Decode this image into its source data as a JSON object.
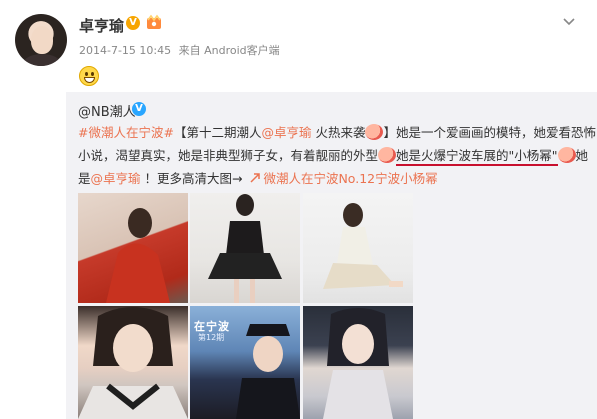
{
  "user": {
    "name": "卓亨瑜",
    "timestamp": "2014-7-15 10:45",
    "source": "来自 Android客户端"
  },
  "icons": {
    "vip": "vip-badge-icon",
    "crown": "crown-badge-icon",
    "more": "chevron-down-icon",
    "grin": "grin-emoji-icon",
    "verified": "verified-v-icon",
    "link": "link-arrow-icon"
  },
  "repost": {
    "author": "@NB潮人",
    "text": {
      "hashtag": "#微潮人在宁波#",
      "l1_a": "【第十二期潮人",
      "l1_mention": "@卓亨瑜",
      "l1_b": " 火热来袭",
      "l1_c": "】她是一个爱画画的模特，她爱看恐怖",
      "l2_a": "小说，渴望真实，她是非典型狮子女，有着靓丽的外型",
      "l2_highlight": "她是火爆宁波车展的\"小杨幂\"",
      "l2_b": "她",
      "l3_a": "是",
      "l3_mention": "@卓亨瑜",
      "l3_b": " ！更多高清大图→ ",
      "l3_link": "微潮人在宁波No.12宁波小杨幂"
    },
    "photo_text": {
      "sign_main": "在宁波",
      "sign_sub": "第12期"
    }
  },
  "colors": {
    "link": "#eb7350",
    "underline": "#c8102e",
    "repost_bg": "#f2f2f5"
  }
}
